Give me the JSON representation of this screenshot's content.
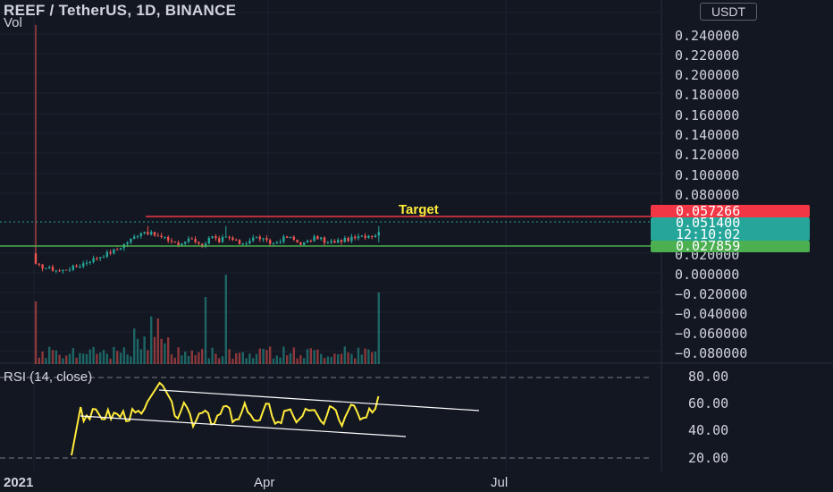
{
  "header": {
    "symbol_title": "REEF / TetherUS, 1D, BINANCE",
    "vol_label": "Vol",
    "rsi_label": "RSI (14, close)",
    "currency": "USDT"
  },
  "price_axis": {
    "ticks": [
      "0.240000",
      "0.220000",
      "0.200000",
      "0.180000",
      "0.160000",
      "0.140000",
      "0.120000",
      "0.100000",
      "0.080000",
      "0.020000",
      "0.000000",
      "−0.020000",
      "−0.040000",
      "−0.060000",
      "−0.080000"
    ]
  },
  "rsi_axis": {
    "ticks": [
      "80.00",
      "60.00",
      "40.00",
      "20.00"
    ]
  },
  "time_axis": {
    "ticks": [
      "2021",
      "Apr",
      "Jul"
    ]
  },
  "badges": {
    "target_price": "0.057266",
    "last_price": "0.051400",
    "countdown": "12:10:02",
    "support_price": "0.027859"
  },
  "annotations": {
    "target_text": "Target"
  },
  "colors": {
    "background": "#131722",
    "up": "#26a69a",
    "down": "#ef5350",
    "target_line": "#f23645",
    "support_line": "#4caf50",
    "rsi_line": "#ffeb3b",
    "channel_line": "#ffffff"
  },
  "chart_data": {
    "type": "candlestick",
    "series": [
      {
        "name": "REEF / TetherUS",
        "kind": "price",
        "last": 0.0514,
        "levels": {
          "target": 0.057266,
          "support": 0.027859
        }
      },
      {
        "name": "Vol",
        "kind": "volume"
      },
      {
        "name": "RSI (14, close)",
        "kind": "rsi",
        "last": 66,
        "ylim": [
          10,
          90
        ]
      }
    ],
    "ylim_price": [
      -0.09,
      0.25
    ]
  }
}
